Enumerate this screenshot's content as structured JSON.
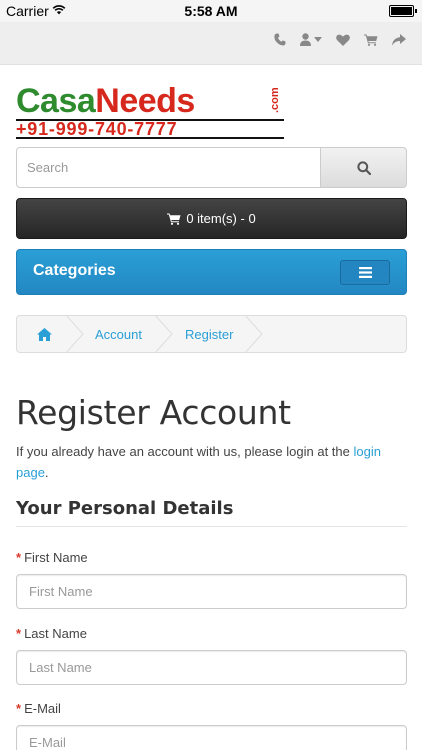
{
  "status_bar": {
    "carrier": "Carrier",
    "time": "5:58 AM"
  },
  "top_nav": {
    "icons": [
      "phone-icon",
      "user-icon",
      "heart-icon",
      "cart-icon",
      "share-icon"
    ]
  },
  "logo": {
    "casa": "Casa",
    "needs": "Needs",
    "com": ".com",
    "phone": "+91-999-740-7777"
  },
  "search": {
    "placeholder": "Search"
  },
  "cart": {
    "label": "0 item(s) - 0"
  },
  "categories": {
    "label": "Categories"
  },
  "breadcrumb": {
    "items": [
      "Account",
      "Register"
    ]
  },
  "page": {
    "title": "Register Account",
    "intro_prefix": "If you already have an account with us, please login at the ",
    "intro_link": "login page",
    "intro_suffix": ".",
    "section_title": "Your Personal Details"
  },
  "form": {
    "required_mark": "*",
    "first_name": {
      "label": "First Name",
      "placeholder": "First Name"
    },
    "last_name": {
      "label": "Last Name",
      "placeholder": "Last Name"
    },
    "email": {
      "label": "E-Mail",
      "placeholder": "E-Mail"
    }
  },
  "colors": {
    "accent": "#2a9fd6",
    "dark_bar": "#333333",
    "required": "#d63a2b"
  }
}
